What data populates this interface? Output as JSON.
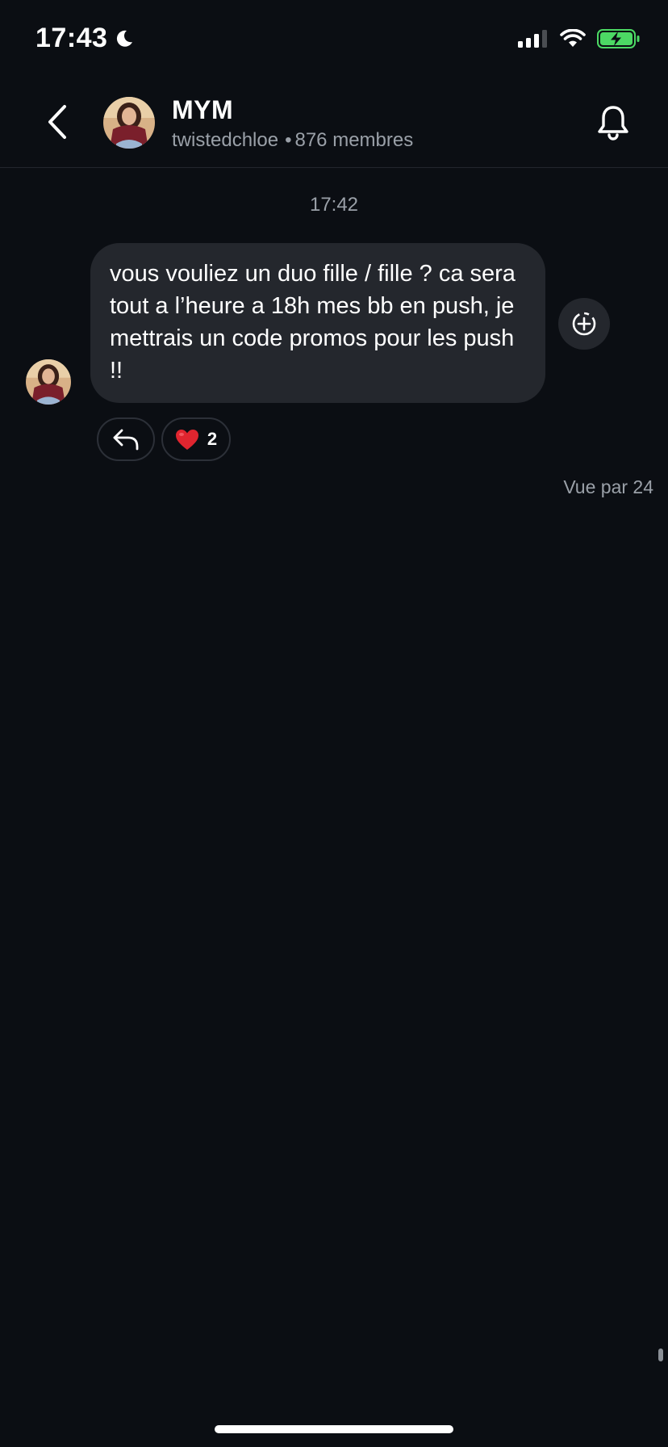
{
  "status_bar": {
    "time": "17:43",
    "icons": [
      "moon-icon",
      "signal-icon",
      "wifi-icon",
      "battery-charging-icon"
    ],
    "battery_color": "#4cd964"
  },
  "header": {
    "title": "MYM",
    "username": "twistedchloe",
    "separator": "•",
    "members": "876 membres",
    "icons": [
      "back-chevron-icon",
      "bell-icon"
    ]
  },
  "chat": {
    "timestamp": "17:42",
    "message": {
      "text": "vous vouliez un duo fille / fille ? ca sera tout a l’heure a 18h mes bb en push, je mettrais un code promos pour les push !!"
    },
    "reactions": {
      "emoji_icon": "heart-icon",
      "count": "2"
    },
    "seen_by": "Vue par 24"
  },
  "colors": {
    "background": "#0b0e13",
    "bubble": "#24272d",
    "muted_text": "#9aa0a8",
    "heart": "#e0252f"
  }
}
